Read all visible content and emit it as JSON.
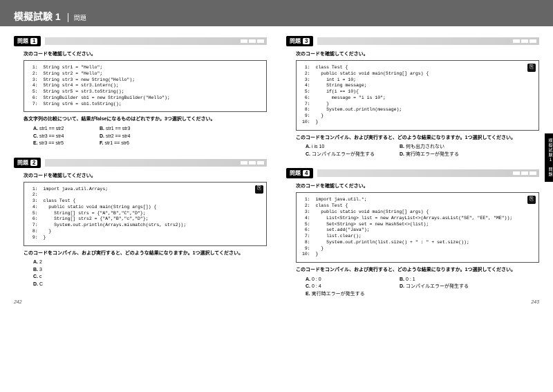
{
  "header": {
    "title": "模擬試験 1",
    "sub": "問題"
  },
  "page_left_num": "242",
  "page_right_num": "243",
  "side_tab": "模擬試験１　問題",
  "q1": {
    "label": "問題",
    "num": "1",
    "instruction": "次のコードを確認してください。",
    "code": " 1:  String str1 = \"Hello\";\n 2:  String str2 = \"Hello\";\n 3:  String str3 = new String(\"Hello\");\n 4:  String str4 = str3.intern();\n 5:  String str5 = str3.toString();\n 6:  StringBuilder sb1 = new StringBuilder(\"Hello\");\n 7:  String str6 = sb1.toString();",
    "question": "各文字列の比較について、結果がfalseになるものはどれですか。3つ選択してください。",
    "opts": [
      [
        {
          "k": "A.",
          "v": "str1 == str2"
        },
        {
          "k": "B.",
          "v": "str1 == str3"
        }
      ],
      [
        {
          "k": "C.",
          "v": "str3 == str4"
        },
        {
          "k": "D.",
          "v": "str2 == str4"
        }
      ],
      [
        {
          "k": "E.",
          "v": "str3 == str5"
        },
        {
          "k": "F.",
          "v": "str1 == str6"
        }
      ]
    ]
  },
  "q2": {
    "label": "問題",
    "num": "2",
    "instruction": "次のコードを確認してください。",
    "code": " 1:  import java.util.Arrays;\n 2:\n 3:  class Test {\n 4:    public static void main(String args[]) {\n 5:      String[] strs = {\"A\",\"B\",\"C\",\"D\"};\n 6:      String[] strs2 = {\"A\",\"B\",\"c\",\"D\"};\n 7:      System.out.println(Arrays.mismatch(strs, strs2));\n 8:    }\n 9:  }",
    "question": "このコードをコンパイル、および実行すると、どのような結果になりますか。1つ選択してください。",
    "opts": [
      [
        {
          "k": "A.",
          "v": "2"
        }
      ],
      [
        {
          "k": "B.",
          "v": "3"
        }
      ],
      [
        {
          "k": "C.",
          "v": "c"
        }
      ],
      [
        {
          "k": "D.",
          "v": "C"
        }
      ]
    ]
  },
  "q3": {
    "label": "問題",
    "num": "3",
    "instruction": "次のコードを確認してください。",
    "code": " 1:  class Test {\n 2:    public static void main(String[] args) {\n 3:      int i = 10;\n 4:      String message;\n 5:      if(i == 10){\n 6:        message = \"i is 10\";\n 7:      }\n 8:      System.out.println(message);\n 9:    }\n10:  }",
    "question": "このコードをコンパイル、および実行すると、どのような結果になりますか。1つ選択してください。",
    "opts": [
      [
        {
          "k": "A.",
          "v": "i is 10"
        },
        {
          "k": "B.",
          "v": "何も出力されない"
        }
      ],
      [
        {
          "k": "C.",
          "v": "コンパイルエラーが発生する"
        },
        {
          "k": "D.",
          "v": "実行時エラーが発生する"
        }
      ]
    ]
  },
  "q4": {
    "label": "問題",
    "num": "4",
    "instruction": "次のコードを確認してください。",
    "code": " 1:  import java.util.*;\n 2:  class Test {\n 3:    public static void main(String[] args) {\n 4:      List<String> list = new ArrayList<>(Arrays.asList(\"SE\", \"EE\", \"ME\"));\n 5:      Set<String> set = new HashSet<>(list);\n 6:      set.add(\"Java\");\n 7:      list.clear();\n 8:      System.out.println(list.size() + \" : \" + set.size());\n 9:    }\n10:  }",
    "question": "このコードをコンパイル、および実行すると、どのような結果になりますか。1つ選択してください。",
    "opts": [
      [
        {
          "k": "A.",
          "v": "0 : 0"
        },
        {
          "k": "B.",
          "v": "0 : 1"
        }
      ],
      [
        {
          "k": "C.",
          "v": "0 : 4"
        },
        {
          "k": "D.",
          "v": "コンパイルエラーが発生する"
        }
      ],
      [
        {
          "k": "E.",
          "v": "実行時エラーが発生する"
        }
      ]
    ]
  }
}
